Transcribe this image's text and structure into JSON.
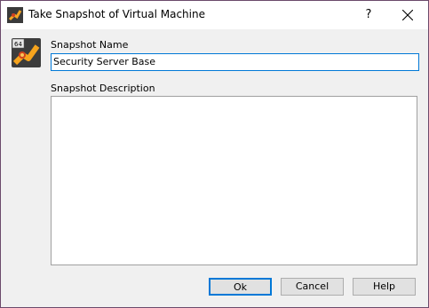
{
  "window": {
    "title": "Take Snapshot of Virtual Machine",
    "help_glyph": "?",
    "accent_color": "#0078d7",
    "vm_badge": "64"
  },
  "form": {
    "name_label": "Snapshot Name",
    "name_value": "Security Server Base",
    "description_label": "Snapshot Description",
    "description_value": ""
  },
  "buttons": {
    "ok": "Ok",
    "cancel": "Cancel",
    "help": "Help"
  }
}
